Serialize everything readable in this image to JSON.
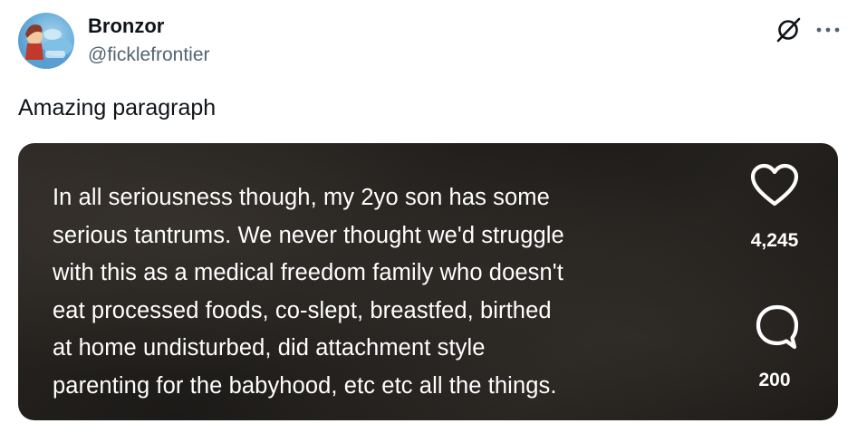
{
  "author": {
    "name": "Bronzor",
    "handle": "@ficklefrontier"
  },
  "icons": {
    "grok": "grok-icon",
    "more": "more-icon",
    "heart": "heart-icon",
    "comment": "comment-icon"
  },
  "tweet": {
    "text": "Amazing paragraph"
  },
  "media": {
    "lines": [
      "In all seriousness though, my 2yo son has some",
      "serious tantrums. We never thought we'd struggle",
      "with this as a medical freedom family who doesn't",
      "eat processed foods, co-slept, breastfed, birthed",
      "at home undisturbed, did attachment style",
      "parenting for the babyhood, etc etc all the things."
    ],
    "like_count": "4,245",
    "comment_count": "200"
  },
  "colors": {
    "text": "#0f1419",
    "secondary_text": "#536471",
    "media_bg": "#1f1c1a"
  }
}
